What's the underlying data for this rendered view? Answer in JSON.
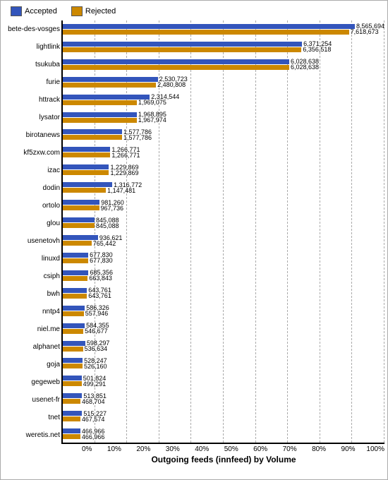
{
  "legend": {
    "accepted_label": "Accepted",
    "accepted_color": "#3355bb",
    "rejected_label": "Rejected",
    "rejected_color": "#cc8800"
  },
  "x_axis": {
    "title": "Outgoing feeds (innfeed) by Volume",
    "ticks": [
      "0%",
      "10%",
      "20%",
      "30%",
      "40%",
      "50%",
      "60%",
      "70%",
      "80%",
      "90%",
      "100%"
    ]
  },
  "bars": [
    {
      "name": "bete-des-vosges",
      "accepted": 8565694,
      "rejected": 7618673,
      "max": 8565694
    },
    {
      "name": "lightlink",
      "accepted": 6371254,
      "rejected": 6356518,
      "max": 8565694
    },
    {
      "name": "tsukuba",
      "accepted": 6028638,
      "rejected": 6028638,
      "max": 8565694
    },
    {
      "name": "furie",
      "accepted": 2530723,
      "rejected": 2480808,
      "max": 8565694
    },
    {
      "name": "httrack",
      "accepted": 2314544,
      "rejected": 1969075,
      "max": 8565694
    },
    {
      "name": "lysator",
      "accepted": 1968895,
      "rejected": 1967974,
      "max": 8565694
    },
    {
      "name": "birotanews",
      "accepted": 1577786,
      "rejected": 1577786,
      "max": 8565694
    },
    {
      "name": "kf5zxw.com",
      "accepted": 1266771,
      "rejected": 1266771,
      "max": 8565694
    },
    {
      "name": "izac",
      "accepted": 1229869,
      "rejected": 1229869,
      "max": 8565694
    },
    {
      "name": "dodin",
      "accepted": 1316772,
      "rejected": 1147481,
      "max": 8565694
    },
    {
      "name": "ortolo",
      "accepted": 981260,
      "rejected": 967736,
      "max": 8565694
    },
    {
      "name": "glou",
      "accepted": 845088,
      "rejected": 845088,
      "max": 8565694
    },
    {
      "name": "usenetovh",
      "accepted": 936621,
      "rejected": 765442,
      "max": 8565694
    },
    {
      "name": "linuxd",
      "accepted": 677830,
      "rejected": 677830,
      "max": 8565694
    },
    {
      "name": "csiph",
      "accepted": 685356,
      "rejected": 663843,
      "max": 8565694
    },
    {
      "name": "bwh",
      "accepted": 643761,
      "rejected": 643761,
      "max": 8565694
    },
    {
      "name": "nntp4",
      "accepted": 586326,
      "rejected": 557946,
      "max": 8565694
    },
    {
      "name": "niel.me",
      "accepted": 584355,
      "rejected": 546677,
      "max": 8565694
    },
    {
      "name": "alphanet",
      "accepted": 598297,
      "rejected": 536634,
      "max": 8565694
    },
    {
      "name": "goja",
      "accepted": 528247,
      "rejected": 526160,
      "max": 8565694
    },
    {
      "name": "gegeweb",
      "accepted": 501824,
      "rejected": 499291,
      "max": 8565694
    },
    {
      "name": "usenet-fr",
      "accepted": 513851,
      "rejected": 468704,
      "max": 8565694
    },
    {
      "name": "tnet",
      "accepted": 515227,
      "rejected": 467574,
      "max": 8565694
    },
    {
      "name": "weretis.net",
      "accepted": 466966,
      "rejected": 466966,
      "max": 8565694
    }
  ]
}
